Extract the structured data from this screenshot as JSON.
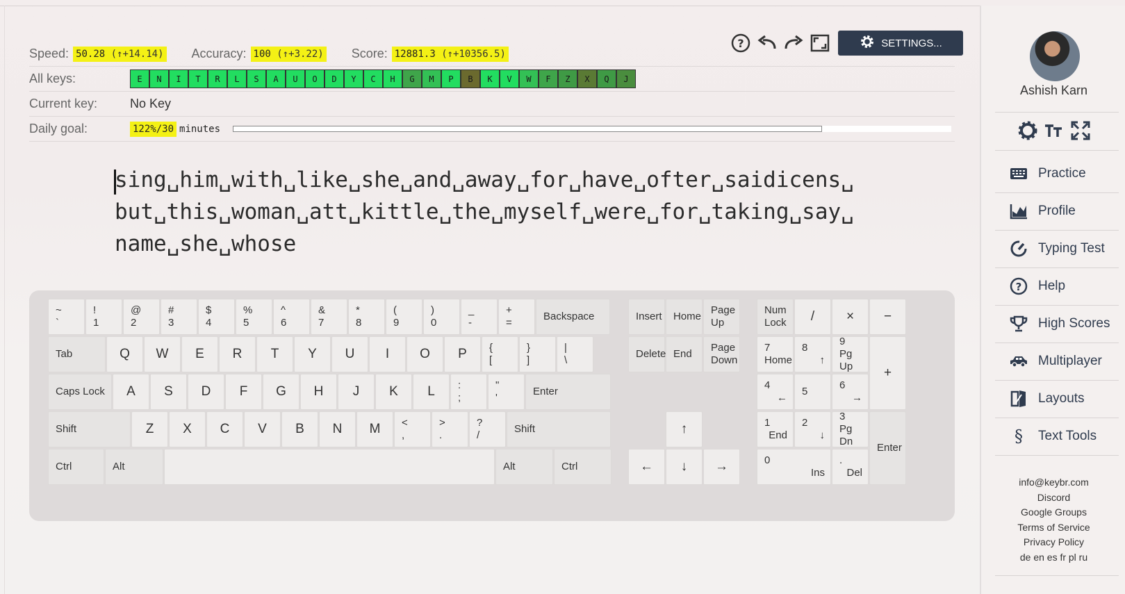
{
  "stats": {
    "speed_label": "Speed:",
    "speed_value": "50.28",
    "speed_delta": "(↑+14.14)",
    "accuracy_label": "Accuracy:",
    "accuracy_value": "100",
    "accuracy_delta": "(↑+3.22)",
    "score_label": "Score:",
    "score_value": "12881.3",
    "score_delta": "(↑+10356.5)"
  },
  "all_keys": {
    "label": "All keys:",
    "keys": [
      {
        "k": "E",
        "color": "#22dd60"
      },
      {
        "k": "N",
        "color": "#22dd60"
      },
      {
        "k": "I",
        "color": "#22dd60"
      },
      {
        "k": "T",
        "color": "#22dd60"
      },
      {
        "k": "R",
        "color": "#22dd60"
      },
      {
        "k": "L",
        "color": "#22dd60"
      },
      {
        "k": "S",
        "color": "#22dd60"
      },
      {
        "k": "A",
        "color": "#22dd60"
      },
      {
        "k": "U",
        "color": "#22dd60"
      },
      {
        "k": "O",
        "color": "#22dd60"
      },
      {
        "k": "D",
        "color": "#22dd60"
      },
      {
        "k": "Y",
        "color": "#22dd60"
      },
      {
        "k": "C",
        "color": "#22dd60"
      },
      {
        "k": "H",
        "color": "#22dd60"
      },
      {
        "k": "G",
        "color": "#3fa54a"
      },
      {
        "k": "M",
        "color": "#33c055"
      },
      {
        "k": "P",
        "color": "#22dd60"
      },
      {
        "k": "B",
        "color": "#6b6a2e"
      },
      {
        "k": "K",
        "color": "#22dd60"
      },
      {
        "k": "V",
        "color": "#22dd60"
      },
      {
        "k": "W",
        "color": "#33c055"
      },
      {
        "k": "F",
        "color": "#3fa54a"
      },
      {
        "k": "Z",
        "color": "#3f9a45"
      },
      {
        "k": "X",
        "color": "#5a7a34"
      },
      {
        "k": "Q",
        "color": "#3f9a45"
      },
      {
        "k": "J",
        "color": "#4a8d3e"
      }
    ]
  },
  "current_key": {
    "label": "Current key:",
    "value": "No Key"
  },
  "daily_goal": {
    "label": "Daily goal:",
    "value": "122%/30",
    "unit": "minutes",
    "progress": 1.22
  },
  "toolbar": {
    "settings_label": "SETTINGS..."
  },
  "practice_text": [
    "sing␣him␣with␣like␣she␣and␣away␣for␣have␣ofter␣saidicens␣",
    "but␣this␣woman␣att␣kittle␣the␣myself␣were␣for␣taking␣say␣",
    "name␣she␣whose"
  ],
  "keyboard": {
    "row1": [
      [
        "~",
        "`"
      ],
      [
        "!",
        "1"
      ],
      [
        "@",
        "2"
      ],
      [
        "#",
        "3"
      ],
      [
        "$",
        "4"
      ],
      [
        "%",
        "5"
      ],
      [
        "^",
        "6"
      ],
      [
        "&",
        "7"
      ],
      [
        "*",
        "8"
      ],
      [
        "(",
        "9"
      ],
      [
        ")",
        "0"
      ],
      [
        "_",
        "-"
      ],
      [
        "+",
        "="
      ]
    ],
    "backspace": "Backspace",
    "tab": "Tab",
    "row2": [
      "Q",
      "W",
      "E",
      "R",
      "T",
      "Y",
      "U",
      "I",
      "O",
      "P"
    ],
    "row2_sym": [
      [
        "{",
        "["
      ],
      [
        "}",
        "]"
      ],
      [
        "|",
        "\\"
      ]
    ],
    "caps": "Caps Lock",
    "row3": [
      "A",
      "S",
      "D",
      "F",
      "G",
      "H",
      "J",
      "K",
      "L"
    ],
    "row3_sym": [
      [
        ":",
        ";"
      ],
      [
        "\"",
        "'"
      ]
    ],
    "enter": "Enter",
    "shift": "Shift",
    "row4": [
      "Z",
      "X",
      "C",
      "V",
      "B",
      "N",
      "M"
    ],
    "row4_sym": [
      [
        "<",
        ","
      ],
      [
        ">",
        "."
      ],
      [
        "?",
        "/"
      ]
    ],
    "ctrl": "Ctrl",
    "alt": "Alt",
    "nav": {
      "insert": "Insert",
      "home": "Home",
      "page_up": [
        "Page",
        "Up"
      ],
      "delete": "Delete",
      "end": "End",
      "page_down": [
        "Page",
        "Down"
      ]
    },
    "arrows": {
      "up": "↑",
      "left": "←",
      "down": "↓",
      "right": "→"
    },
    "numpad": {
      "numlock": [
        "Num",
        "Lock"
      ],
      "div": "/",
      "mul": "×",
      "minus": "−",
      "plus": "+",
      "enter": "Enter",
      "n7": [
        "7",
        "Home"
      ],
      "n8": [
        "8",
        "↑"
      ],
      "n9": [
        "9",
        "Pg Up"
      ],
      "n4": [
        "4",
        "←"
      ],
      "n5": "5",
      "n6": [
        "6",
        "→"
      ],
      "n1": [
        "1",
        "End"
      ],
      "n2": [
        "2",
        "↓"
      ],
      "n3": [
        "3",
        "Pg Dn"
      ],
      "n0": [
        "0",
        "Ins"
      ],
      "dot": [
        ".",
        "Del"
      ]
    }
  },
  "sidebar": {
    "user_name": "Ashish Karn",
    "nav": [
      {
        "label": "Practice",
        "icon": "keyboard-icon"
      },
      {
        "label": "Profile",
        "icon": "chart-icon"
      },
      {
        "label": "Typing Test",
        "icon": "gauge-icon"
      },
      {
        "label": "Help",
        "icon": "help-icon"
      },
      {
        "label": "High Scores",
        "icon": "trophy-icon"
      },
      {
        "label": "Multiplayer",
        "icon": "car-icon"
      },
      {
        "label": "Layouts",
        "icon": "layouts-icon"
      },
      {
        "label": "Text Tools",
        "icon": "section-icon"
      }
    ],
    "links": [
      "info@keybr.com",
      "Discord",
      "Google Groups",
      "Terms of Service",
      "Privacy Policy",
      "de en es fr pl ru"
    ]
  }
}
